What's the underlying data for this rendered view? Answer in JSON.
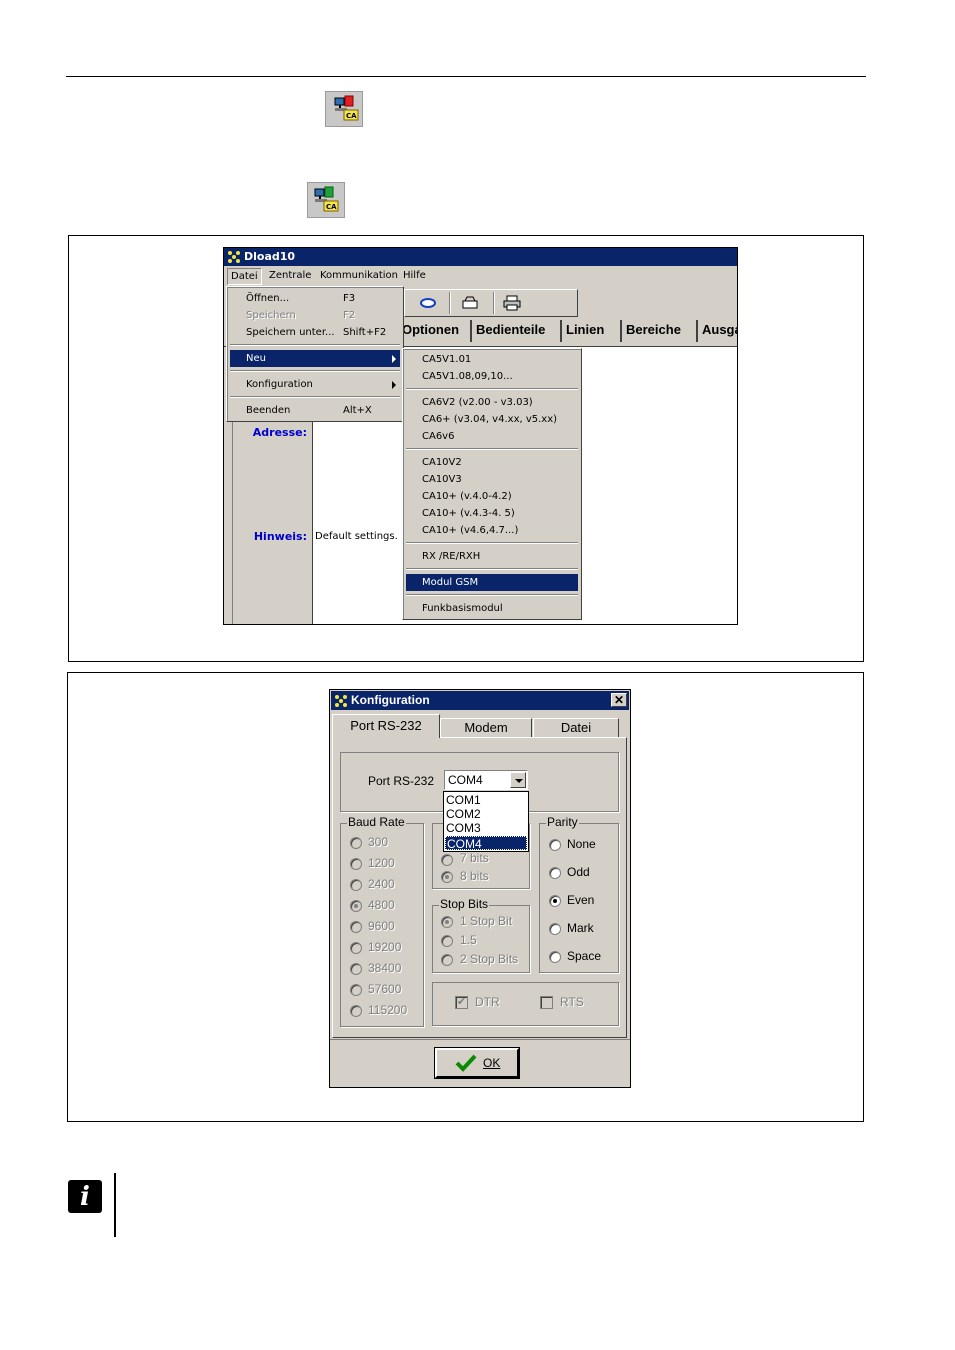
{
  "icons": {
    "top_icon_1": "ca-connection-icon",
    "top_icon_2": "ca-connection-icon"
  },
  "dload": {
    "title": "Dload10",
    "menubar": [
      "Datei",
      "Zentrale",
      "Kommunikation",
      "Hilfe"
    ],
    "tabs": [
      "Optionen",
      "Bedienteile",
      "Linien",
      "Bereiche",
      "Ausga"
    ],
    "labels": {
      "adresse": "Adresse:",
      "hinweis": "Hinweis:",
      "hinweis_value": "Default settings."
    },
    "datei_menu": [
      {
        "label": "Öffnen...",
        "shortcut": "F3"
      },
      {
        "label": "Speichern",
        "shortcut": "F2",
        "disabled": true
      },
      {
        "label": "Speichern unter...",
        "shortcut": "Shift+F2"
      },
      {
        "label": "Neu"
      },
      {
        "label": "Konfiguration"
      },
      {
        "label": "Beenden",
        "shortcut": "Alt+X"
      }
    ],
    "neu_menu": [
      "CA5V1.01",
      "CA5V1.08,09,10...",
      "CA6V2 (v2.00 - v3.03)",
      "CA6+ (v3.04, v4.xx, v5.xx)",
      "CA6v6",
      "CA10V2",
      "CA10V3",
      "CA10+ (v.4.0-4.2)",
      "CA10+ (v.4.3-4. 5)",
      "CA10+ (v4.6,4.7...)",
      "RX /RE/RXH",
      "Modul GSM",
      "Funkbasismodul"
    ]
  },
  "config": {
    "title": "Konfiguration",
    "tabs": [
      "Port RS-232",
      "Modem",
      "Datei"
    ],
    "port_label": "Port RS-232",
    "port_value": "COM4",
    "port_options": [
      "COM1",
      "COM2",
      "COM3",
      "COM4"
    ],
    "baud_title": "Baud Rate",
    "baud_rates": [
      "300",
      "1200",
      "2400",
      "4800",
      "9600",
      "19200",
      "38400",
      "57600",
      "115200"
    ],
    "baud_selected": "4800",
    "data_bits": [
      "7 bits",
      "8 bits"
    ],
    "data_bits_selected": "8 bits",
    "stop_title": "Stop Bits",
    "stop_bits": [
      "1 Stop Bit",
      "1.5",
      "2 Stop Bits"
    ],
    "stop_selected": "1 Stop Bit",
    "parity_title": "Parity",
    "parity": [
      "None",
      "Odd",
      "Even",
      "Mark",
      "Space"
    ],
    "parity_selected": "Even",
    "dtr": "DTR",
    "rts": "RTS",
    "ok": "OK"
  },
  "info_icon": "info-icon",
  "info_letter": "i"
}
